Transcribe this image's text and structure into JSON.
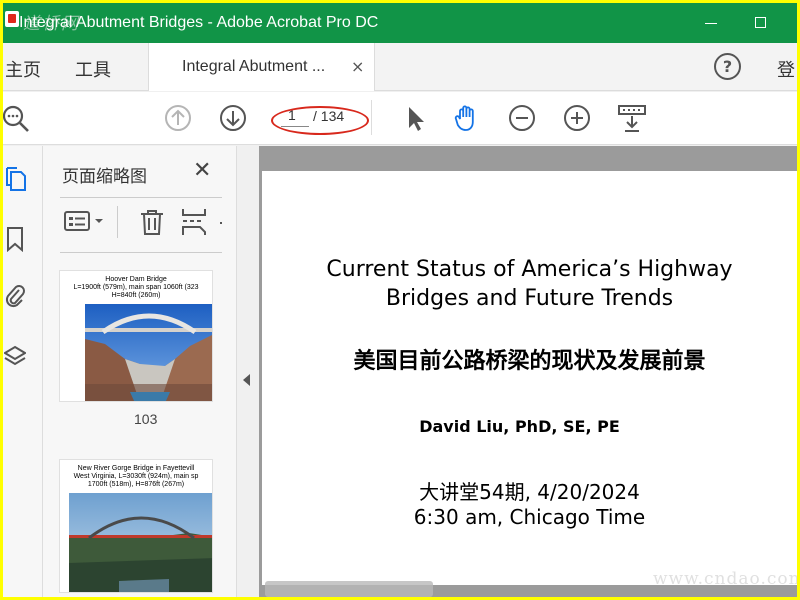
{
  "window": {
    "title": "Integral Abutment Bridges - Adobe Acrobat Pro DC",
    "watermark_top": "道桥网"
  },
  "tabbar": {
    "home": "主页",
    "tools": "工具",
    "doc_tab": "Integral Abutment ...",
    "close_glyph": "×",
    "help_glyph": "?",
    "login": "登"
  },
  "toolbar": {
    "current_page": "1",
    "total_pages": "/ 134"
  },
  "panel": {
    "title": "页面缩略图",
    "close_glyph": "✕",
    "thumbs": [
      {
        "caption": "Hoover Dam Bridge\nL=1900ft (579m), main span 1060ft (323\nH=840ft (260m)",
        "page_number": "103"
      },
      {
        "caption": "New River Gorge Bridge in Fayettevill\nWest Virginia, L=3030ft (924m), main sp\n1700ft (518m), H=876ft (267m)",
        "page_number": ""
      }
    ]
  },
  "slide": {
    "title_line1": "Current Status of America’s Highway",
    "title_line2": "Bridges and Future Trends",
    "title_cn": "美国目前公路桥梁的现状及发展前景",
    "author": "David Liu, PhD, SE, PE",
    "date_line1": "大讲堂54期, 4/20/2024",
    "date_line2": "6:30 am, Chicago Time"
  },
  "watermark_bottom": "www.cndao.com",
  "colors": {
    "titlebar": "#119447",
    "highlight_ellipse": "#d8281c",
    "frame_border": "#ffff00"
  }
}
